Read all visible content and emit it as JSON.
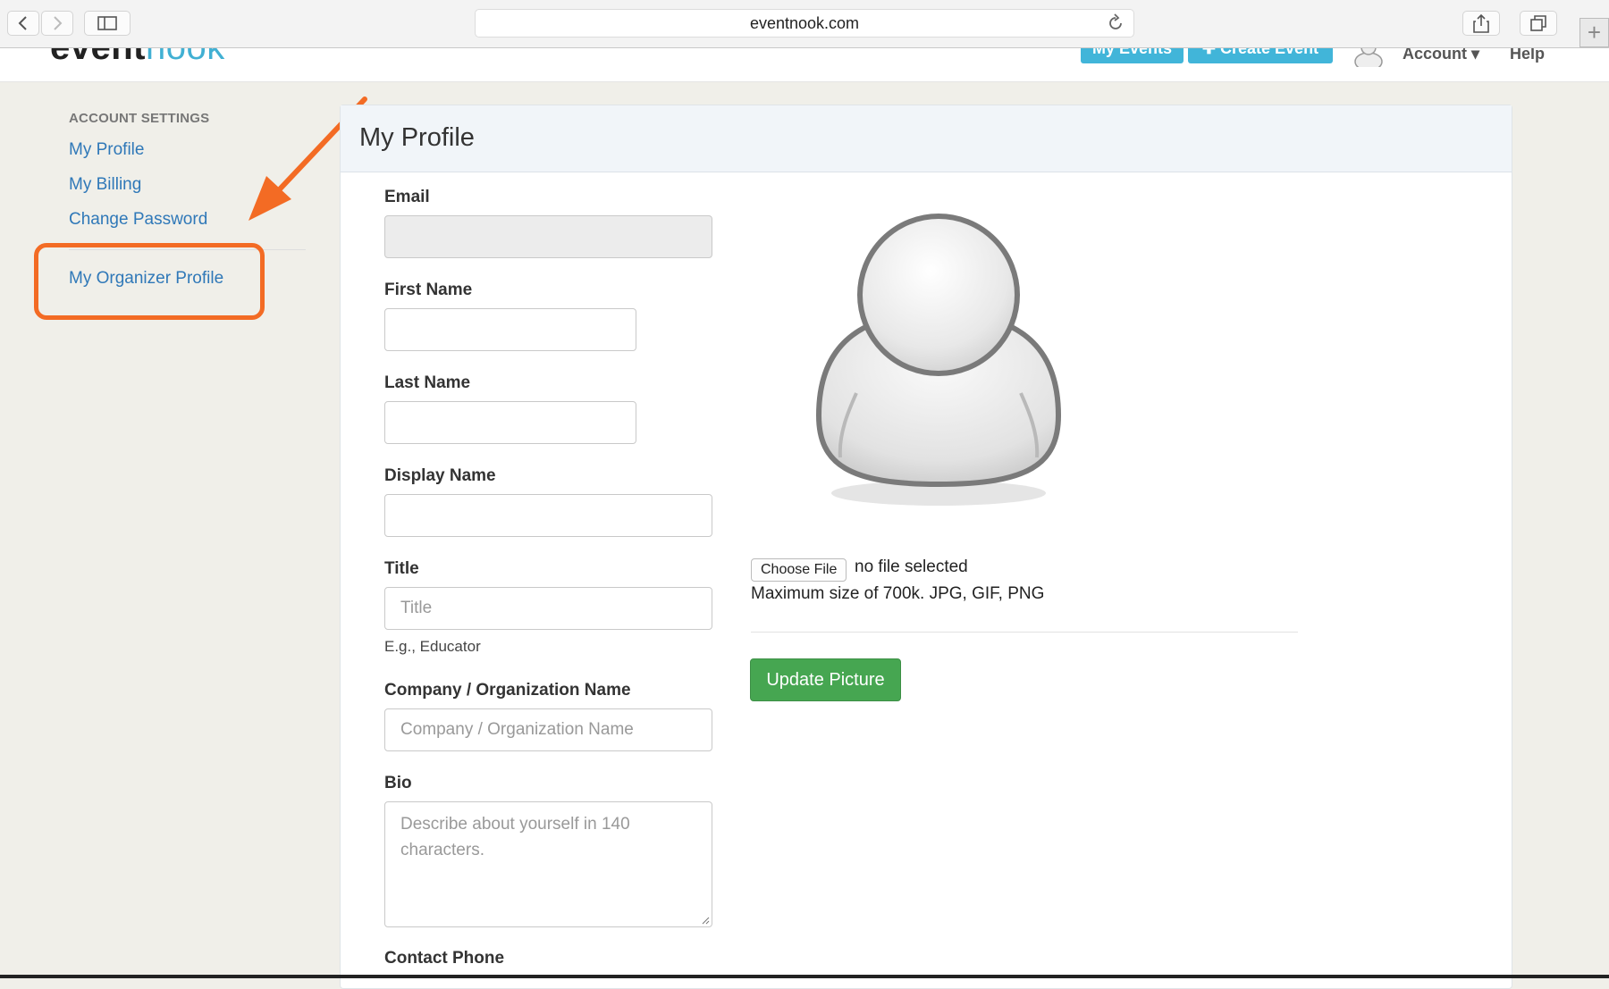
{
  "browser": {
    "url": "eventnook.com"
  },
  "site": {
    "logo_part1": "event",
    "logo_part2": "nook",
    "nav": {
      "my_events": "My Events",
      "create_event": "✚ Create Event",
      "account": "Account ▾",
      "help": "Help"
    }
  },
  "sidebar": {
    "heading": "ACCOUNT SETTINGS",
    "items": [
      {
        "label": "My Profile"
      },
      {
        "label": "My Billing"
      },
      {
        "label": "Change Password"
      },
      {
        "label": "My Organizer Profile"
      }
    ]
  },
  "panel": {
    "title": "My Profile",
    "fields": {
      "email_label": "Email",
      "first_name_label": "First Name",
      "last_name_label": "Last Name",
      "display_name_label": "Display Name",
      "title_label": "Title",
      "title_placeholder": "Title",
      "title_help": "E.g., Educator",
      "company_label": "Company / Organization Name",
      "company_placeholder": "Company / Organization Name",
      "bio_label": "Bio",
      "bio_placeholder": "Describe about yourself in 140\ncharacters.",
      "contact_phone_label": "Contact Phone"
    },
    "picture": {
      "choose_file": "Choose File",
      "no_file": "no file selected",
      "max_size": "Maximum size of 700k. JPG, GIF, PNG",
      "update_button": "Update Picture"
    }
  },
  "colors": {
    "accent": "#41b5d9",
    "link": "#2f78b8",
    "highlight": "#f36b24",
    "button_green": "#46a651"
  }
}
